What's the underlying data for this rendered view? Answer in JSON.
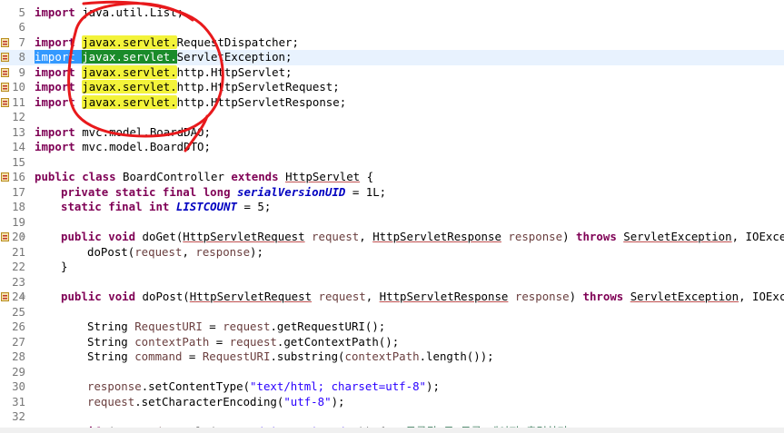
{
  "editor": {
    "lines": [
      {
        "num": "5",
        "marker": false,
        "fold": "",
        "current": false,
        "segs": [
          [
            "kw",
            "import"
          ],
          [
            "t",
            " java.util.List;"
          ]
        ]
      },
      {
        "num": "6",
        "marker": false,
        "fold": "",
        "current": false,
        "segs": []
      },
      {
        "num": "7",
        "marker": true,
        "fold": "",
        "current": false,
        "segs": [
          [
            "kw",
            "import"
          ],
          [
            "t",
            " "
          ],
          [
            "hl",
            "javax.servlet."
          ],
          [
            "t",
            "RequestDispatcher;"
          ]
        ]
      },
      {
        "num": "8",
        "marker": true,
        "fold": "",
        "current": true,
        "segs": [
          [
            "sel",
            "import "
          ],
          [
            "occ",
            "javax.servlet."
          ],
          [
            "t",
            "ServletException;"
          ]
        ]
      },
      {
        "num": "9",
        "marker": true,
        "fold": "",
        "current": false,
        "segs": [
          [
            "kw",
            "import"
          ],
          [
            "t",
            " "
          ],
          [
            "hl",
            "javax.servlet."
          ],
          [
            "t",
            "http.HttpServlet;"
          ]
        ]
      },
      {
        "num": "10",
        "marker": true,
        "fold": "",
        "current": false,
        "segs": [
          [
            "kw",
            "import"
          ],
          [
            "t",
            " "
          ],
          [
            "hl",
            "javax.servlet."
          ],
          [
            "t",
            "http.HttpServletRequest;"
          ]
        ]
      },
      {
        "num": "11",
        "marker": true,
        "fold": "",
        "current": false,
        "segs": [
          [
            "kw",
            "import"
          ],
          [
            "t",
            " "
          ],
          [
            "hl",
            "javax.servlet."
          ],
          [
            "t",
            "http.HttpServletResponse;"
          ]
        ]
      },
      {
        "num": "12",
        "marker": false,
        "fold": "",
        "current": false,
        "segs": []
      },
      {
        "num": "13",
        "marker": false,
        "fold": "",
        "current": false,
        "segs": [
          [
            "kw",
            "import"
          ],
          [
            "t",
            " mvc.model.BoardDAO;"
          ]
        ]
      },
      {
        "num": "14",
        "marker": false,
        "fold": "",
        "current": false,
        "segs": [
          [
            "kw",
            "import"
          ],
          [
            "t",
            " mvc.model.BoardDTO;"
          ]
        ]
      },
      {
        "num": "15",
        "marker": false,
        "fold": "",
        "current": false,
        "segs": []
      },
      {
        "num": "16",
        "marker": true,
        "fold": "",
        "current": false,
        "segs": [
          [
            "kw",
            "public"
          ],
          [
            "t",
            " "
          ],
          [
            "kw",
            "class"
          ],
          [
            "t",
            " BoardController "
          ],
          [
            "kw",
            "extends"
          ],
          [
            "t",
            " "
          ],
          [
            "ul",
            "HttpServlet"
          ],
          [
            "t",
            " {"
          ]
        ]
      },
      {
        "num": "17",
        "marker": false,
        "fold": "",
        "current": false,
        "segs": [
          [
            "tab1",
            ""
          ],
          [
            "kw",
            "private"
          ],
          [
            "t",
            " "
          ],
          [
            "kw",
            "static"
          ],
          [
            "t",
            " "
          ],
          [
            "kw",
            "final"
          ],
          [
            "t",
            " "
          ],
          [
            "kw",
            "long"
          ],
          [
            "t",
            " "
          ],
          [
            "sfi",
            "serialVersionUID"
          ],
          [
            "t",
            " = 1L;"
          ]
        ]
      },
      {
        "num": "18",
        "marker": false,
        "fold": "",
        "current": false,
        "segs": [
          [
            "tab1",
            ""
          ],
          [
            "kw",
            "static"
          ],
          [
            "t",
            " "
          ],
          [
            "kw",
            "final"
          ],
          [
            "t",
            " "
          ],
          [
            "kw",
            "int"
          ],
          [
            "t",
            " "
          ],
          [
            "sfi",
            "LISTCOUNT"
          ],
          [
            "t",
            " = 5;"
          ]
        ]
      },
      {
        "num": "19",
        "marker": false,
        "fold": "",
        "current": false,
        "segs": []
      },
      {
        "num": "20",
        "marker": true,
        "fold": "⊖",
        "current": false,
        "segs": [
          [
            "tab1",
            ""
          ],
          [
            "kw",
            "public"
          ],
          [
            "t",
            " "
          ],
          [
            "kw",
            "void"
          ],
          [
            "t",
            " doGet("
          ],
          [
            "ul",
            "HttpServletRequest"
          ],
          [
            "t",
            " "
          ],
          [
            "var",
            "request"
          ],
          [
            "t",
            ", "
          ],
          [
            "ul",
            "HttpServletResponse"
          ],
          [
            "t",
            " "
          ],
          [
            "var",
            "response"
          ],
          [
            "t",
            ") "
          ],
          [
            "kw",
            "throws"
          ],
          [
            "t",
            " "
          ],
          [
            "ul",
            "ServletException"
          ],
          [
            "t",
            ", IOExceptio"
          ]
        ]
      },
      {
        "num": "21",
        "marker": false,
        "fold": "",
        "current": false,
        "segs": [
          [
            "tab2",
            ""
          ],
          [
            "t",
            "doPost("
          ],
          [
            "var",
            "request"
          ],
          [
            "t",
            ", "
          ],
          [
            "var",
            "response"
          ],
          [
            "t",
            ");"
          ]
        ]
      },
      {
        "num": "22",
        "marker": false,
        "fold": "",
        "current": false,
        "segs": [
          [
            "tab1",
            ""
          ],
          [
            "t",
            "}"
          ]
        ]
      },
      {
        "num": "23",
        "marker": false,
        "fold": "",
        "current": false,
        "segs": []
      },
      {
        "num": "24",
        "marker": true,
        "fold": "⊖",
        "current": false,
        "segs": [
          [
            "tab1",
            ""
          ],
          [
            "kw",
            "public"
          ],
          [
            "t",
            " "
          ],
          [
            "kw",
            "void"
          ],
          [
            "t",
            " doPost("
          ],
          [
            "ul",
            "HttpServletRequest"
          ],
          [
            "t",
            " "
          ],
          [
            "var",
            "request"
          ],
          [
            "t",
            ", "
          ],
          [
            "ul",
            "HttpServletResponse"
          ],
          [
            "t",
            " "
          ],
          [
            "var",
            "response"
          ],
          [
            "t",
            ") "
          ],
          [
            "kw",
            "throws"
          ],
          [
            "t",
            " "
          ],
          [
            "ul",
            "ServletException"
          ],
          [
            "t",
            ", IOExcepti"
          ]
        ]
      },
      {
        "num": "25",
        "marker": false,
        "fold": "",
        "current": false,
        "segs": []
      },
      {
        "num": "26",
        "marker": false,
        "fold": "",
        "current": false,
        "segs": [
          [
            "tab2",
            ""
          ],
          [
            "t",
            "String "
          ],
          [
            "var",
            "RequestURI"
          ],
          [
            "t",
            " = "
          ],
          [
            "var",
            "request"
          ],
          [
            "t",
            ".getRequestURI();"
          ]
        ]
      },
      {
        "num": "27",
        "marker": false,
        "fold": "",
        "current": false,
        "segs": [
          [
            "tab2",
            ""
          ],
          [
            "t",
            "String "
          ],
          [
            "var",
            "contextPath"
          ],
          [
            "t",
            " = "
          ],
          [
            "var",
            "request"
          ],
          [
            "t",
            ".getContextPath();"
          ]
        ]
      },
      {
        "num": "28",
        "marker": false,
        "fold": "",
        "current": false,
        "segs": [
          [
            "tab2",
            ""
          ],
          [
            "t",
            "String "
          ],
          [
            "var",
            "command"
          ],
          [
            "t",
            " = "
          ],
          [
            "var",
            "RequestURI"
          ],
          [
            "t",
            ".substring("
          ],
          [
            "var",
            "contextPath"
          ],
          [
            "t",
            ".length());"
          ]
        ]
      },
      {
        "num": "29",
        "marker": false,
        "fold": "",
        "current": false,
        "segs": []
      },
      {
        "num": "30",
        "marker": false,
        "fold": "",
        "current": false,
        "segs": [
          [
            "tab2",
            ""
          ],
          [
            "var",
            "response"
          ],
          [
            "t",
            ".setContentType("
          ],
          [
            "str",
            "\"text/html; charset=utf-8\""
          ],
          [
            "t",
            ");"
          ]
        ]
      },
      {
        "num": "31",
        "marker": false,
        "fold": "",
        "current": false,
        "segs": [
          [
            "tab2",
            ""
          ],
          [
            "var",
            "request"
          ],
          [
            "t",
            ".setCharacterEncoding("
          ],
          [
            "str",
            "\"utf-8\""
          ],
          [
            "t",
            ");"
          ]
        ]
      },
      {
        "num": "32",
        "marker": false,
        "fold": "",
        "current": false,
        "segs": []
      },
      {
        "num": "33",
        "marker": false,
        "fold": "",
        "current": false,
        "segs": [
          [
            "tab2",
            ""
          ],
          [
            "kw",
            "if"
          ],
          [
            "t",
            " ("
          ],
          [
            "var",
            "command"
          ],
          [
            "t",
            ".equals("
          ],
          [
            "str",
            "\"/BoardListAction.do\""
          ],
          [
            "t",
            ")) { "
          ],
          [
            "cmt",
            "//등록된 글 목록 페이지 출력하기"
          ]
        ]
      }
    ],
    "colors": {
      "annotation_circle": "#e8191c",
      "highlight": "#f3f33a",
      "selection": "#3399ff",
      "occurrence": "#1a8b2a",
      "keyword": "#7f0055"
    }
  }
}
